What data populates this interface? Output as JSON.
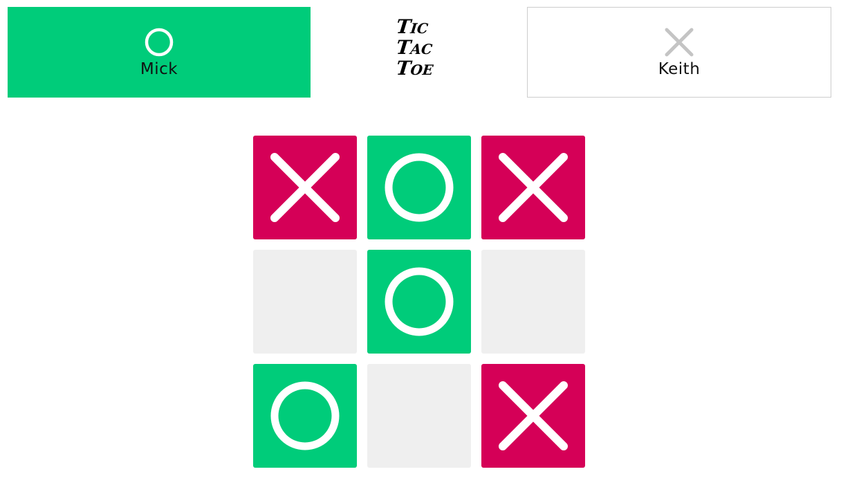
{
  "colors": {
    "o_color": "#00cc7a",
    "x_color": "#d50057",
    "empty_color": "#efefef",
    "inactive_icon": "#c4c4c4"
  },
  "players": [
    {
      "name": "Mick",
      "symbol": "O",
      "icon": "circle-icon",
      "active": true
    },
    {
      "name": "Keith",
      "symbol": "X",
      "icon": "cross-icon",
      "active": false
    }
  ],
  "logo": {
    "lines": [
      "Tic",
      "Tac",
      "Toe"
    ]
  },
  "board": [
    [
      "X",
      "O",
      "X"
    ],
    [
      "",
      "O",
      ""
    ],
    [
      "O",
      "",
      "X"
    ]
  ]
}
